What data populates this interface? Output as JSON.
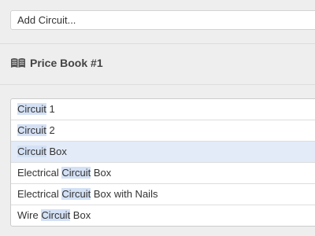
{
  "add_circuit": {
    "placeholder": "Add Circuit..."
  },
  "price_book": {
    "icon": "book-icon",
    "title": "Price Book #1"
  },
  "results": [
    {
      "before": "",
      "match": "Circuit",
      "after": " 1",
      "selected": false
    },
    {
      "before": "",
      "match": "Circuit",
      "after": " 2",
      "selected": false
    },
    {
      "before": "",
      "match": "Circuit",
      "after": " Box",
      "selected": true
    },
    {
      "before": "Electrical ",
      "match": "Circuit",
      "after": " Box",
      "selected": false
    },
    {
      "before": "Electrical ",
      "match": "Circuit",
      "after": " Box with Nails",
      "selected": false
    },
    {
      "before": "Wire ",
      "match": "Circuit",
      "after": " Box",
      "selected": false
    }
  ],
  "colors": {
    "highlight": "#d4e1f5",
    "selected_row": "#e3ebf8",
    "background": "#eeeeee"
  }
}
